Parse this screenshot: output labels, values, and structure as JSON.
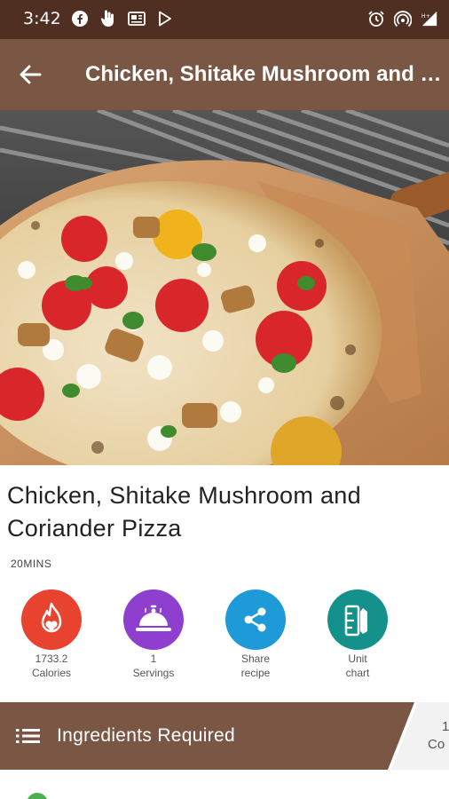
{
  "status_bar": {
    "time": "3:42",
    "left_icons": [
      "facebook-icon",
      "hand-icon",
      "news-icon",
      "play-store-icon"
    ],
    "right_icons": [
      "alarm-icon",
      "hotspot-icon",
      "signal-icon"
    ]
  },
  "app_bar": {
    "title": "Chicken, Shitake Mushroom and Coriander Pizza",
    "back_icon": "arrow-left-icon"
  },
  "recipe": {
    "title": "Chicken, Shitake Mushroom and Coriander Pizza",
    "time": "20MINS"
  },
  "actions": [
    {
      "icon": "flame-heart-icon",
      "line1": "1733.2",
      "line2": "Calories",
      "color": "#e8432e"
    },
    {
      "icon": "cloche-icon",
      "line1": "1",
      "line2": "Servings",
      "color": "#8e3fd0"
    },
    {
      "icon": "share-icon",
      "line1": "Share",
      "line2": "recipe",
      "color": "#1e9ad8"
    },
    {
      "icon": "ruler-chart-icon",
      "line1": "Unit",
      "line2": "chart",
      "color": "#15918b"
    }
  ],
  "ingredients_bar": {
    "label": "Ingredients Required",
    "count_line1": "1",
    "count_line2": "Co",
    "color": "#7a5645"
  }
}
